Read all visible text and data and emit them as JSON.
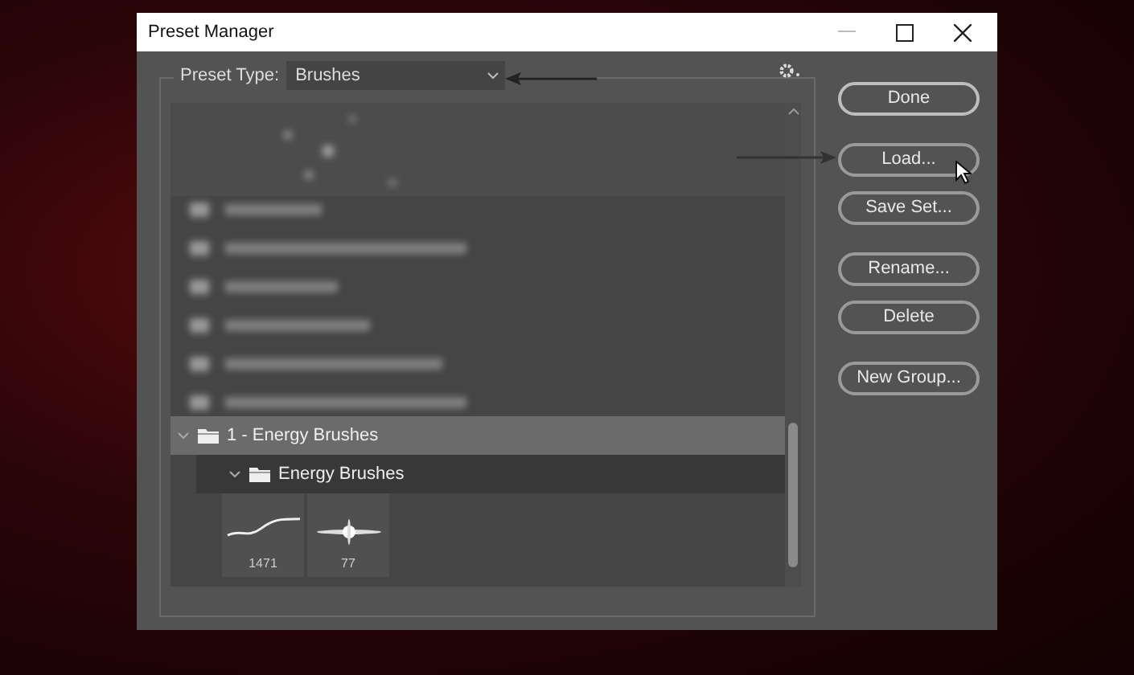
{
  "window": {
    "title": "Preset Manager"
  },
  "preset_type": {
    "label": "Preset Type:",
    "value": "Brushes"
  },
  "groups": [
    {
      "name": "1 - Energy Brushes",
      "expanded": true,
      "children": [
        {
          "name": "Energy Brushes",
          "expanded": true,
          "brushes": [
            {
              "kind": "stroke",
              "size": "1471"
            },
            {
              "kind": "flare",
              "size": "77"
            }
          ]
        }
      ]
    }
  ],
  "buttons": [
    {
      "label": "Done",
      "kind": "primary"
    },
    {
      "label": "Load...",
      "kind": "normal"
    },
    {
      "label": "Save Set...",
      "kind": "normal"
    },
    {
      "label": "Rename...",
      "kind": "normal"
    },
    {
      "label": "Delete",
      "kind": "normal"
    },
    {
      "label": "New Group...",
      "kind": "normal"
    }
  ]
}
